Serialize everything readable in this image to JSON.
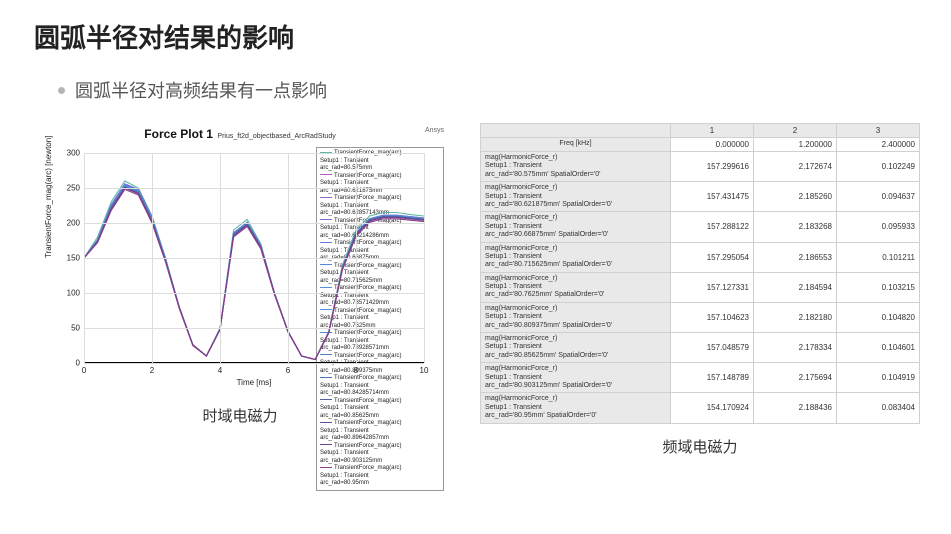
{
  "title": "圆弧半径对结果的影响",
  "bullet": "圆弧半径对高频结果有一点影响",
  "captions": {
    "left": "时域电磁力",
    "right": "频域电磁力"
  },
  "chart_data": {
    "type": "line",
    "title": "Force Plot 1",
    "subtitle": "Prius_ft2d_objectbased_ArcRadStudy",
    "corner_logo": "Ansys",
    "xlabel": "Time [ms]",
    "ylabel": "TransientForce_mag(arc) [newton]",
    "xlim": [
      0,
      10
    ],
    "ylim": [
      0,
      300
    ],
    "xticks": [
      0,
      2,
      4,
      6,
      8,
      10
    ],
    "yticks": [
      0,
      50,
      100,
      150,
      200,
      250,
      300
    ],
    "x": [
      0,
      0.4,
      0.8,
      1.2,
      1.6,
      2.0,
      2.4,
      2.8,
      3.2,
      3.6,
      4.0,
      4.4,
      4.8,
      5.2,
      5.6,
      6.0,
      6.4,
      6.8,
      7.2,
      7.6,
      8.0,
      8.4,
      8.8,
      9.2,
      9.6,
      10.0
    ],
    "series": [
      {
        "name": "arc_rad=80.575mm",
        "color": "#5fb7a8",
        "values": [
          150,
          180,
          230,
          260,
          250,
          210,
          150,
          80,
          25,
          10,
          50,
          190,
          205,
          170,
          100,
          45,
          10,
          5,
          45,
          140,
          190,
          210,
          215,
          215,
          212,
          210
        ]
      },
      {
        "name": "arc_rad=80.621875mm",
        "color": "#b45cc0",
        "values": [
          150,
          175,
          225,
          255,
          248,
          208,
          148,
          80,
          26,
          10,
          48,
          185,
          200,
          168,
          100,
          45,
          10,
          5,
          43,
          135,
          185,
          205,
          210,
          210,
          208,
          206
        ]
      },
      {
        "name": "arc_rad=80.62857143mm",
        "color": "#8a64c8",
        "values": [
          150,
          176,
          226,
          256,
          248,
          208,
          148,
          80,
          26,
          10,
          48,
          186,
          201,
          168,
          100,
          45,
          10,
          5,
          44,
          136,
          186,
          206,
          211,
          211,
          209,
          207
        ]
      },
      {
        "name": "arc_rad=80.66214286mm",
        "color": "#7a6fd0",
        "values": [
          150,
          176,
          225,
          255,
          247,
          207,
          148,
          80,
          26,
          10,
          48,
          186,
          201,
          168,
          100,
          45,
          10,
          5,
          44,
          136,
          186,
          206,
          211,
          211,
          209,
          207
        ]
      },
      {
        "name": "arc_rad=80.66875mm",
        "color": "#6a7ad8",
        "values": [
          150,
          176,
          225,
          255,
          247,
          207,
          148,
          80,
          26,
          10,
          48,
          186,
          201,
          168,
          100,
          45,
          10,
          5,
          44,
          136,
          186,
          206,
          211,
          211,
          209,
          207
        ]
      },
      {
        "name": "arc_rad=80.715625mm",
        "color": "#5a85df",
        "values": [
          150,
          175,
          224,
          254,
          246,
          206,
          148,
          80,
          26,
          10,
          48,
          185,
          200,
          167,
          100,
          45,
          10,
          5,
          44,
          135,
          185,
          205,
          210,
          210,
          208,
          206
        ]
      },
      {
        "name": "arc_rad=80.73571429mm",
        "color": "#5090e0",
        "values": [
          150,
          175,
          224,
          254,
          246,
          206,
          148,
          80,
          26,
          10,
          48,
          185,
          200,
          167,
          100,
          45,
          10,
          5,
          44,
          135,
          185,
          205,
          210,
          210,
          208,
          206
        ]
      },
      {
        "name": "arc_rad=80.7625mm",
        "color": "#4c93dc",
        "values": [
          150,
          175,
          223,
          253,
          245,
          205,
          147,
          80,
          26,
          10,
          48,
          184,
          199,
          167,
          100,
          45,
          10,
          5,
          44,
          135,
          185,
          205,
          210,
          210,
          208,
          206
        ]
      },
      {
        "name": "arc_rad=80.78928571mm",
        "color": "#4a8fd0",
        "values": [
          150,
          174,
          222,
          252,
          244,
          204,
          147,
          80,
          26,
          10,
          48,
          184,
          199,
          167,
          100,
          45,
          10,
          5,
          44,
          135,
          185,
          205,
          210,
          210,
          208,
          206
        ]
      },
      {
        "name": "arc_rad=80.809375mm",
        "color": "#4a80c0",
        "values": [
          150,
          174,
          222,
          252,
          244,
          204,
          147,
          80,
          26,
          10,
          48,
          184,
          199,
          166,
          100,
          45,
          10,
          5,
          44,
          135,
          184,
          204,
          209,
          209,
          207,
          205
        ]
      },
      {
        "name": "arc_rad=80.84285714mm",
        "color": "#4a70b0",
        "values": [
          150,
          174,
          221,
          251,
          243,
          203,
          146,
          80,
          26,
          10,
          48,
          183,
          198,
          166,
          100,
          45,
          10,
          5,
          44,
          135,
          184,
          204,
          209,
          209,
          207,
          205
        ]
      },
      {
        "name": "arc_rad=80.85625mm",
        "color": "#4f60a0",
        "values": [
          150,
          174,
          221,
          251,
          243,
          203,
          146,
          80,
          26,
          10,
          48,
          183,
          198,
          166,
          100,
          45,
          10,
          5,
          44,
          135,
          184,
          204,
          209,
          209,
          207,
          205
        ]
      },
      {
        "name": "arc_rad=80.89642857mm",
        "color": "#604f98",
        "values": [
          150,
          173,
          220,
          250,
          242,
          202,
          145,
          80,
          26,
          10,
          48,
          182,
          197,
          165,
          99,
          45,
          10,
          5,
          44,
          134,
          183,
          203,
          208,
          208,
          206,
          204
        ]
      },
      {
        "name": "arc_rad=80.903125mm",
        "color": "#704590",
        "values": [
          150,
          173,
          220,
          250,
          242,
          202,
          145,
          80,
          26,
          10,
          48,
          182,
          197,
          165,
          99,
          45,
          10,
          5,
          44,
          134,
          183,
          203,
          208,
          208,
          206,
          204
        ]
      },
      {
        "name": "arc_rad=80.95mm",
        "color": "#8a3d88",
        "values": [
          150,
          172,
          218,
          248,
          240,
          200,
          144,
          78,
          25,
          10,
          48,
          180,
          195,
          163,
          98,
          44,
          10,
          5,
          43,
          133,
          181,
          201,
          206,
          206,
          204,
          202
        ]
      }
    ],
    "legend_labels": {
      "heading": "TransientForce_mag(arc)",
      "sub": "Setup1 : Transient"
    }
  },
  "freq_table": {
    "header_label": "Freq [kHz]",
    "cols": [
      "1",
      "2",
      "3"
    ],
    "freq_row": [
      "0.000000",
      "1.200000",
      "2.400000"
    ],
    "row_meta": {
      "l1": "mag(HarmonicForce_r)",
      "l2": "Setup1 : Transient",
      "l3_prefix": "arc_rad='",
      "l3_suffix": "' SpatialOrder='0'"
    },
    "rows": [
      {
        "arc": "80.575mm",
        "v": [
          "157.299616",
          "2.172674",
          "0.102249"
        ]
      },
      {
        "arc": "80.621875mm",
        "v": [
          "157.431475",
          "2.185260",
          "0.094637"
        ]
      },
      {
        "arc": "80.66875mm",
        "v": [
          "157.288122",
          "2.183268",
          "0.095933"
        ]
      },
      {
        "arc": "80.715625mm",
        "v": [
          "157.295054",
          "2.186553",
          "0.101211"
        ]
      },
      {
        "arc": "80.7625mm",
        "v": [
          "157.127331",
          "2.184594",
          "0.103215"
        ]
      },
      {
        "arc": "80.809375mm",
        "v": [
          "157.104623",
          "2.182180",
          "0.104820"
        ]
      },
      {
        "arc": "80.85625mm",
        "v": [
          "157.048579",
          "2.178334",
          "0.104601"
        ]
      },
      {
        "arc": "80.903125mm",
        "v": [
          "157.148789",
          "2.175694",
          "0.104919"
        ]
      },
      {
        "arc": "80.95mm",
        "v": [
          "154.170924",
          "2.188436",
          "0.083404"
        ]
      }
    ]
  }
}
